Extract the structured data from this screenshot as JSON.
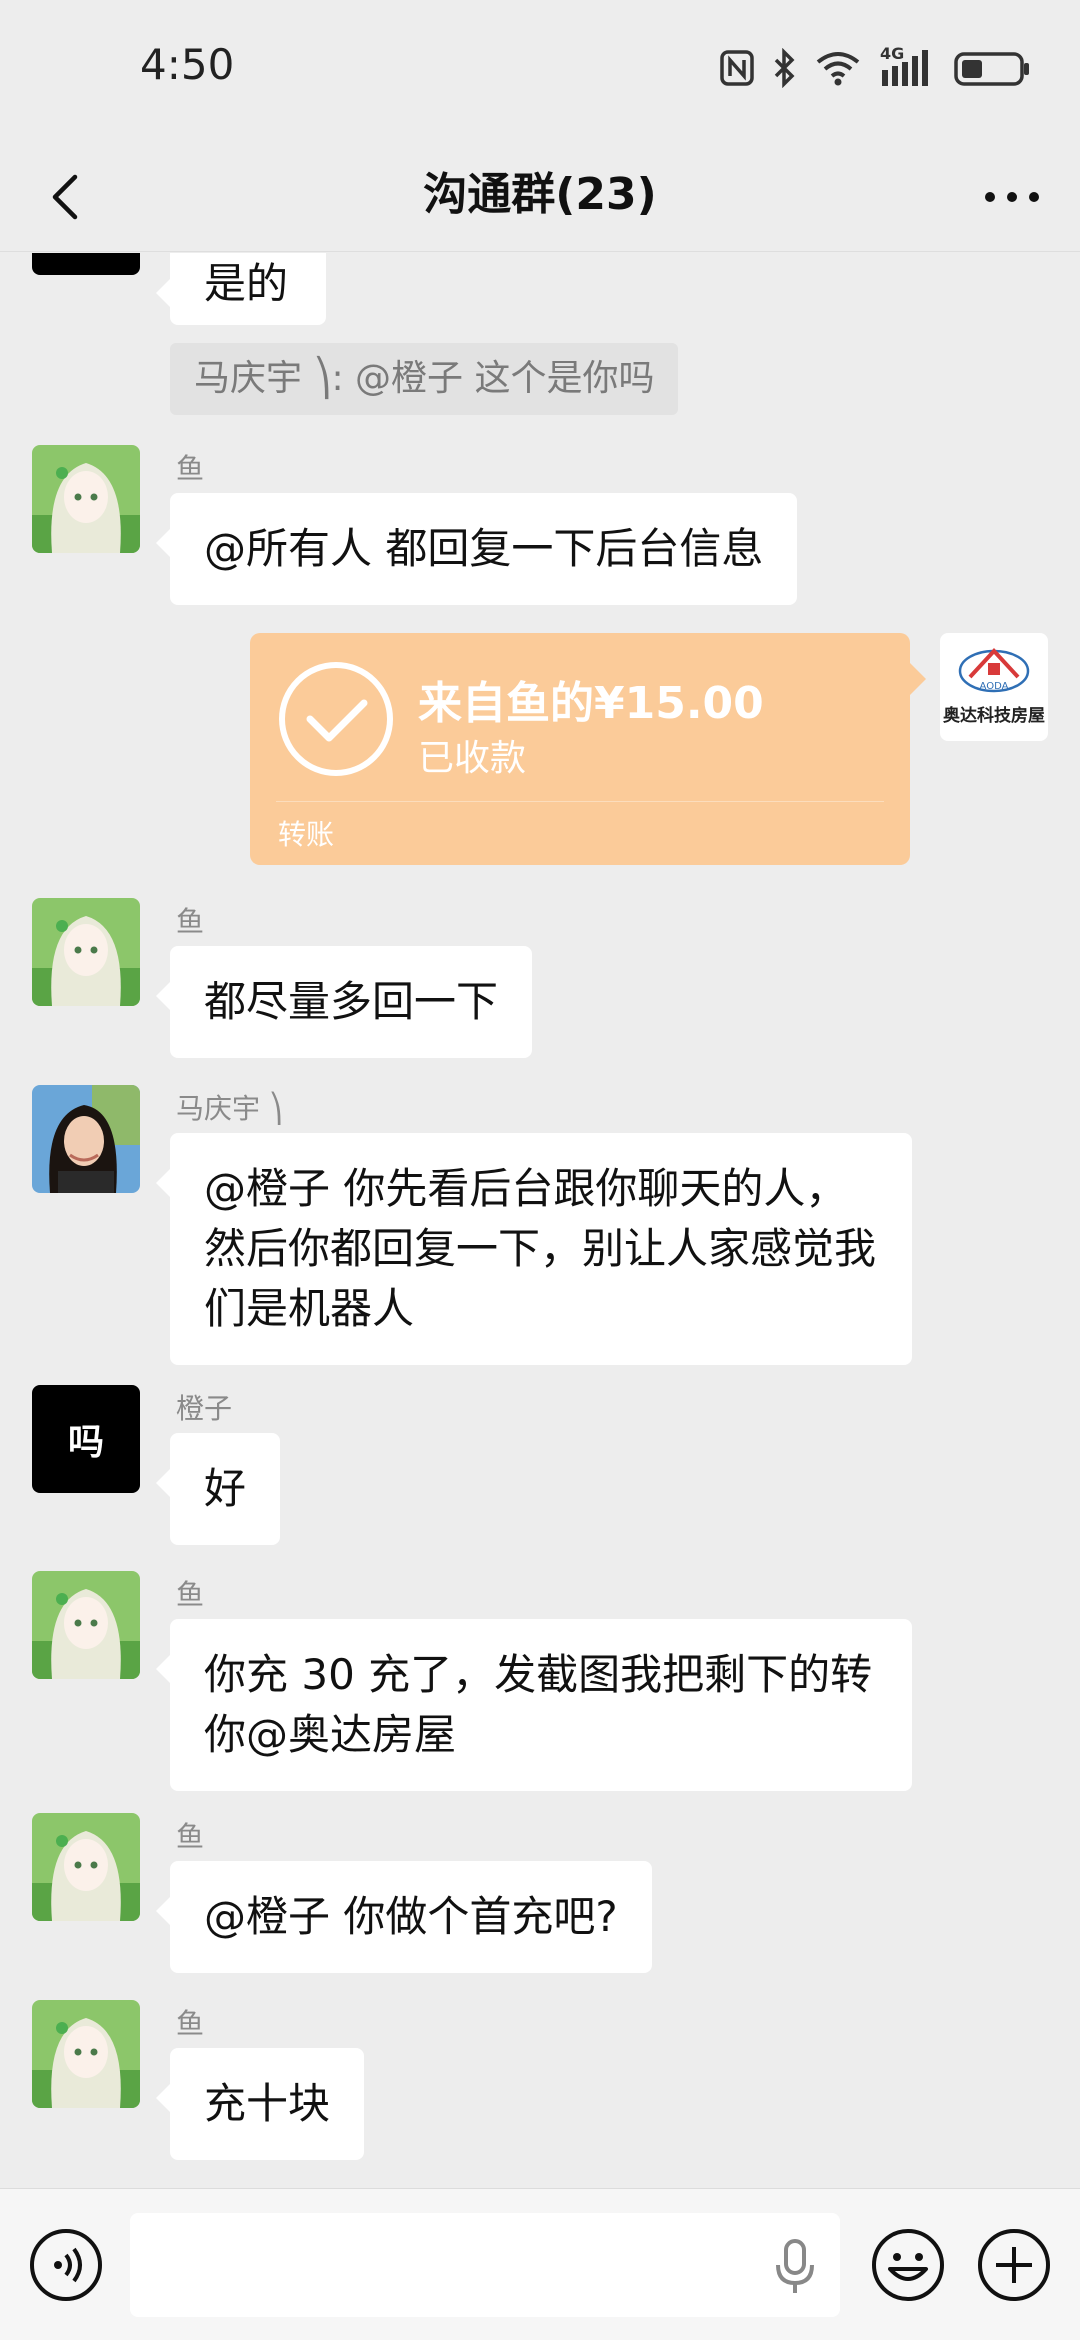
{
  "status_bar": {
    "time": "4:50",
    "network_label": "4G"
  },
  "header": {
    "title": "沟通群(23)"
  },
  "messages": {
    "m0": {
      "text": "是的"
    },
    "quote": {
      "text": "马庆宇 ⎞: @橙子 这个是你吗"
    },
    "m1": {
      "sender": "鱼",
      "text": "@所有人  都回复一下后台信息"
    },
    "transfer": {
      "amount_text": "来自鱼的¥15.00",
      "status": "已收款",
      "label": "转账",
      "receiver_avatar_text": "奥达科技房屋",
      "receiver_logo_text": "AODA"
    },
    "m2": {
      "sender": "鱼",
      "text": "都尽量多回一下"
    },
    "m3": {
      "sender": "马庆宇 ⎞",
      "text": "@橙子  你先看后台跟你聊天的人，然后你都回复一下，别让人家感觉我们是机器人"
    },
    "m4": {
      "sender": "橙子",
      "avatar_text": "吗",
      "text": "好"
    },
    "m5": {
      "sender": "鱼",
      "text": "你充 30 充了，发截图我把剩下的转你@奥达房屋"
    },
    "m6": {
      "sender": "鱼",
      "text": "@橙子  你做个首充吧?"
    },
    "m7": {
      "sender": "鱼",
      "text": "充十块"
    }
  },
  "input_bar": {
    "placeholder": ""
  },
  "colors": {
    "background": "#ededed",
    "bubble": "#ffffff",
    "transfer_card": "#fbcb99",
    "name_gray": "#8a8a8a"
  },
  "icons": {
    "back": "chevron-left-icon",
    "more": "more-dots-icon",
    "voice": "voice-icon",
    "mic": "mic-icon",
    "emoji": "emoji-icon",
    "plus": "plus-icon",
    "check": "check-circle-icon"
  }
}
